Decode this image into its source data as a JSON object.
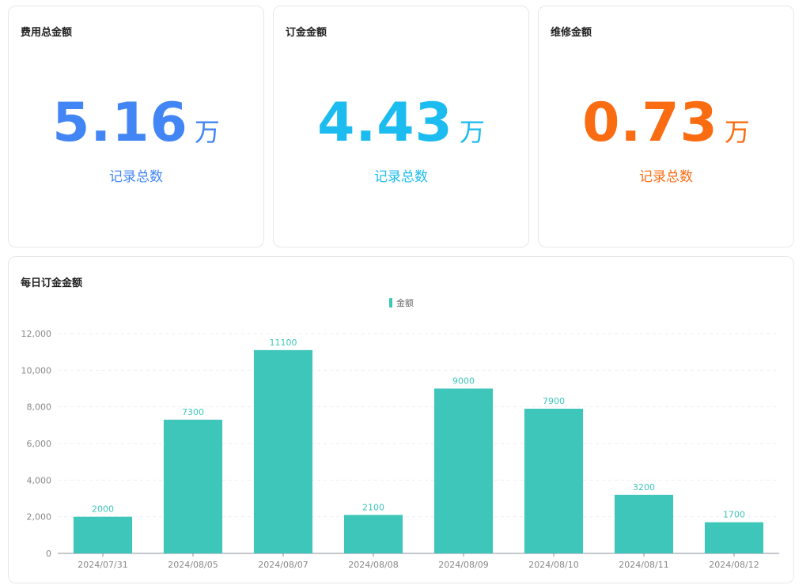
{
  "cards": [
    {
      "title": "费用总金额",
      "value": "5.16",
      "unit": "万",
      "subtitle": "记录总数",
      "color": "#4285f4"
    },
    {
      "title": "订金金额",
      "value": "4.43",
      "unit": "万",
      "subtitle": "记录总数",
      "color": "#1cbcf0"
    },
    {
      "title": "维修金额",
      "value": "0.73",
      "unit": "万",
      "subtitle": "记录总数",
      "color": "#fa6c12"
    }
  ],
  "chart_section": {
    "title": "每日订金金额"
  },
  "chart_data": {
    "type": "bar",
    "title": "",
    "xlabel": "",
    "ylabel": "",
    "categories": [
      "2024/07/31",
      "2024/08/05",
      "2024/08/07",
      "2024/08/08",
      "2024/08/09",
      "2024/08/10",
      "2024/08/11",
      "2024/08/12"
    ],
    "series": [
      {
        "name": "金额",
        "values": [
          2000,
          7300,
          11100,
          2100,
          9000,
          7900,
          3200,
          1700
        ],
        "color": "#3fc6ba"
      }
    ],
    "ylim": [
      0,
      12000
    ],
    "yticks": [
      "0",
      "2,000",
      "4,000",
      "6,000",
      "8,000",
      "10,000",
      "12,000"
    ],
    "show_data_labels": true,
    "grid": "dashed-horizontal",
    "legend_position": "top-center"
  }
}
